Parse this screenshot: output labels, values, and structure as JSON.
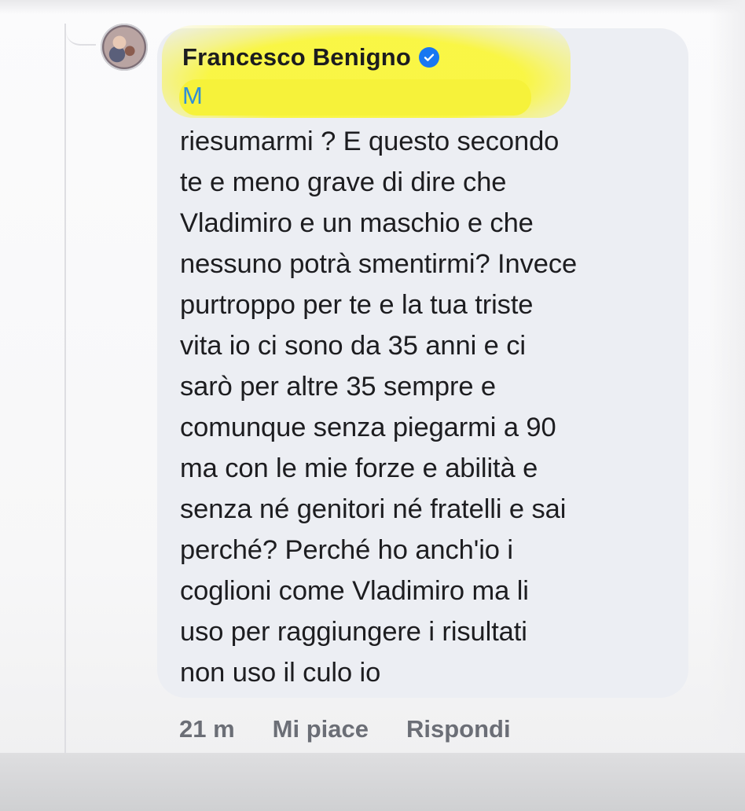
{
  "comment": {
    "author": "Francesco Benigno",
    "author_verified_icon": "verified-badge-icon",
    "tag_initial": "M",
    "text": "riesumarmi ? E questo secondo\nte e meno grave di dire che\nVladimiro e un maschio e che\nnessuno potrà smentirmi? Invece\npurtroppo per te e la tua triste\nvita io ci sono da 35 anni e ci\nsarò per altre 35 sempre e\ncomunque senza piegarmi a 90\nma con le mie forze e abilità e\nsenza né genitori né fratelli e sai\nperché? Perché ho anch'io i\ncoglioni come Vladimiro ma li\nuso per raggiungere i risultati\nnon uso il culo io"
  },
  "actions": {
    "time": "21 m",
    "like_label": "Mi piace",
    "reply_label": "Rispondi"
  },
  "colors": {
    "bubble": "#eceef3",
    "redaction_highlight": "#f6f23a",
    "verified_blue": "#1877f2",
    "action_text": "#6b6e76"
  }
}
